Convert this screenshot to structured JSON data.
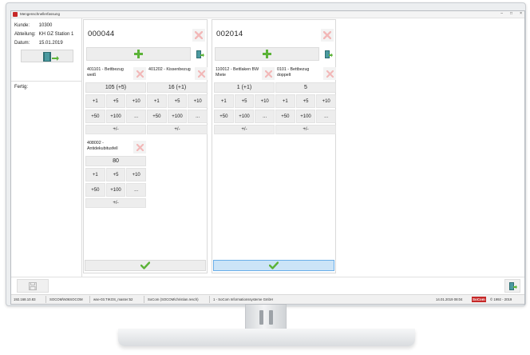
{
  "window": {
    "title": "Mengenschnellerfassung",
    "min": "–",
    "max": "□",
    "close": "×"
  },
  "info": {
    "kunde_label": "Kunde:",
    "kunde_value": "10300",
    "abteilung_label": "Abteilung:",
    "abteilung_value": "KH GZ Station 1",
    "datum_label": "Datum:",
    "datum_value": "15.01.2019",
    "fertig_label": "Fertig:"
  },
  "orders": [
    {
      "number": "000044",
      "items": [
        {
          "name": "401101 - Bettbezug weiß",
          "count": "105 (+5)"
        },
        {
          "name": "401202 - Kissenbezug",
          "count": "16 (+1)"
        },
        {
          "name": "408002 - Antidekubitusfell",
          "count": "80"
        }
      ]
    },
    {
      "number": "002014",
      "items": [
        {
          "name": "110012 - Bettlaken BW Miete",
          "count": "1 (+1)"
        },
        {
          "name": "0101 - Bettbezug doppelt",
          "count": "5"
        }
      ]
    }
  ],
  "increments": [
    "+1",
    "+5",
    "+10",
    "+50",
    "+100",
    "..."
  ],
  "plus_minus": "+/-",
  "status": {
    "ip": "192.168.10.83",
    "domain": "SOCOM\\N06SOCOM",
    "db": "wse-03.TIKOS_master:52",
    "user": "SoCom (SOCOM\\christian.resch)",
    "company": "1 - SoCom Informationssysteme GmbH",
    "datetime": "14.01.2019 08:04",
    "brand": "SoCom",
    "copyright": "© 1992 - 2019"
  },
  "colors": {
    "accent_green": "#5cb338",
    "delete_red": "#f2b8b8",
    "active_confirm": "#cce4f7",
    "brand_red": "#c62828"
  }
}
